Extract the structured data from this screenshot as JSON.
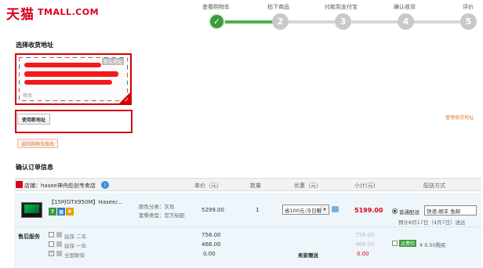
{
  "header": {
    "logo_cn": "天猫",
    "logo_en": "TMALL.COM",
    "steps": [
      {
        "label": "查看购物车",
        "num": "✓"
      },
      {
        "label": "拍下商品",
        "num": "2"
      },
      {
        "label": "付款到支付宝",
        "num": "3"
      },
      {
        "label": "确认收货",
        "num": "4"
      },
      {
        "label": "评价",
        "num": "5"
      }
    ]
  },
  "address": {
    "title": "选择收货地址",
    "default_tag": "默认地址",
    "edit": "修改",
    "use_new": "使用新地址",
    "manage": "管理收货地址",
    "back_cart": "返回购物车修改"
  },
  "order": {
    "title": "确认订单信息",
    "shop_label": "店铺：hasee神舟彪创专卖店",
    "shop_badge": "i",
    "columns": {
      "price": "单价（元）",
      "qty": "数量",
      "discount": "优惠（元）",
      "subtotal": "小计(元)",
      "shipping": "配送方式"
    },
    "product": {
      "name": "【15吋GTX950M】Hasee/...",
      "badges": [
        "7",
        "保",
        "¥"
      ],
      "color": "颜色分类：灰色",
      "service": "套餐类型：官方标配",
      "price": "5299.00",
      "qty": "1",
      "discount": "省100元:冷日鞭",
      "subtotal": "5199.00",
      "ship_label": "普通配送",
      "ship_option": "快递:顺丰 免邮",
      "ship_note": "预计8月17日（4月7日）送达"
    },
    "aftersale": {
      "label": "售后服务",
      "items": [
        {
          "name": "延保 二年",
          "price": "758.00",
          "sub": "758.00"
        },
        {
          "name": "延保 一年",
          "price": "468.00",
          "sub": "468.00"
        },
        {
          "name": "全国联保",
          "price": "0.00",
          "sub": "0.00"
        }
      ],
      "gift": "卖家赠送",
      "huagou_tag": "运费险",
      "huagou_text": "¥ 0.50购买"
    }
  },
  "colors": {
    "brand_red": "#d9001b",
    "step_green": "#3f9a3c",
    "highlight_red": "#d40000"
  }
}
